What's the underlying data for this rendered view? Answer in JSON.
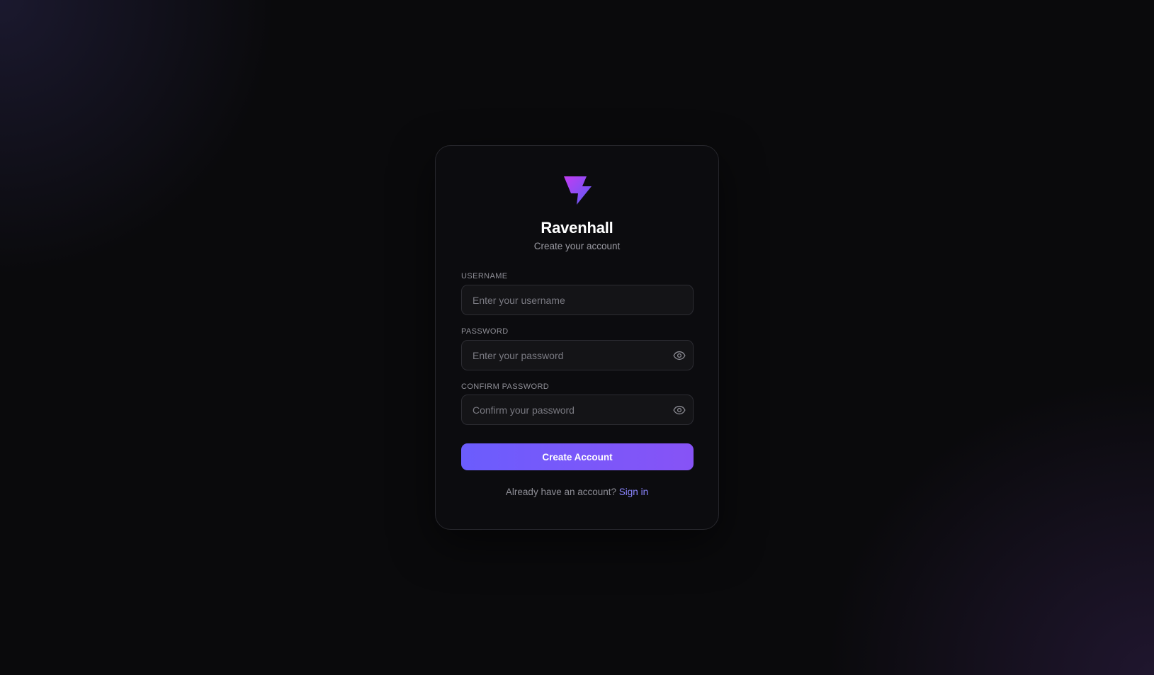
{
  "brand": {
    "name": "Ravenhall",
    "subtitle": "Create your account",
    "logo_icon": "lightning-bolt-icon",
    "logo_gradient": [
      "#c23cf2",
      "#5b5cf6"
    ]
  },
  "form": {
    "username": {
      "label": "USERNAME",
      "placeholder": "Enter your username",
      "value": ""
    },
    "password": {
      "label": "PASSWORD",
      "placeholder": "Enter your password",
      "value": "",
      "toggle_icon": "eye-icon"
    },
    "confirm_password": {
      "label": "CONFIRM PASSWORD",
      "placeholder": "Confirm your password",
      "value": "",
      "toggle_icon": "eye-icon"
    },
    "submit_label": "Create Account"
  },
  "footer": {
    "prompt": "Already have an account?",
    "link_label": "Sign in"
  },
  "colors": {
    "accent": "#6b5dfd",
    "accent_end": "#8753f6",
    "link": "#8b85ff",
    "background": "#0a0a0c"
  }
}
